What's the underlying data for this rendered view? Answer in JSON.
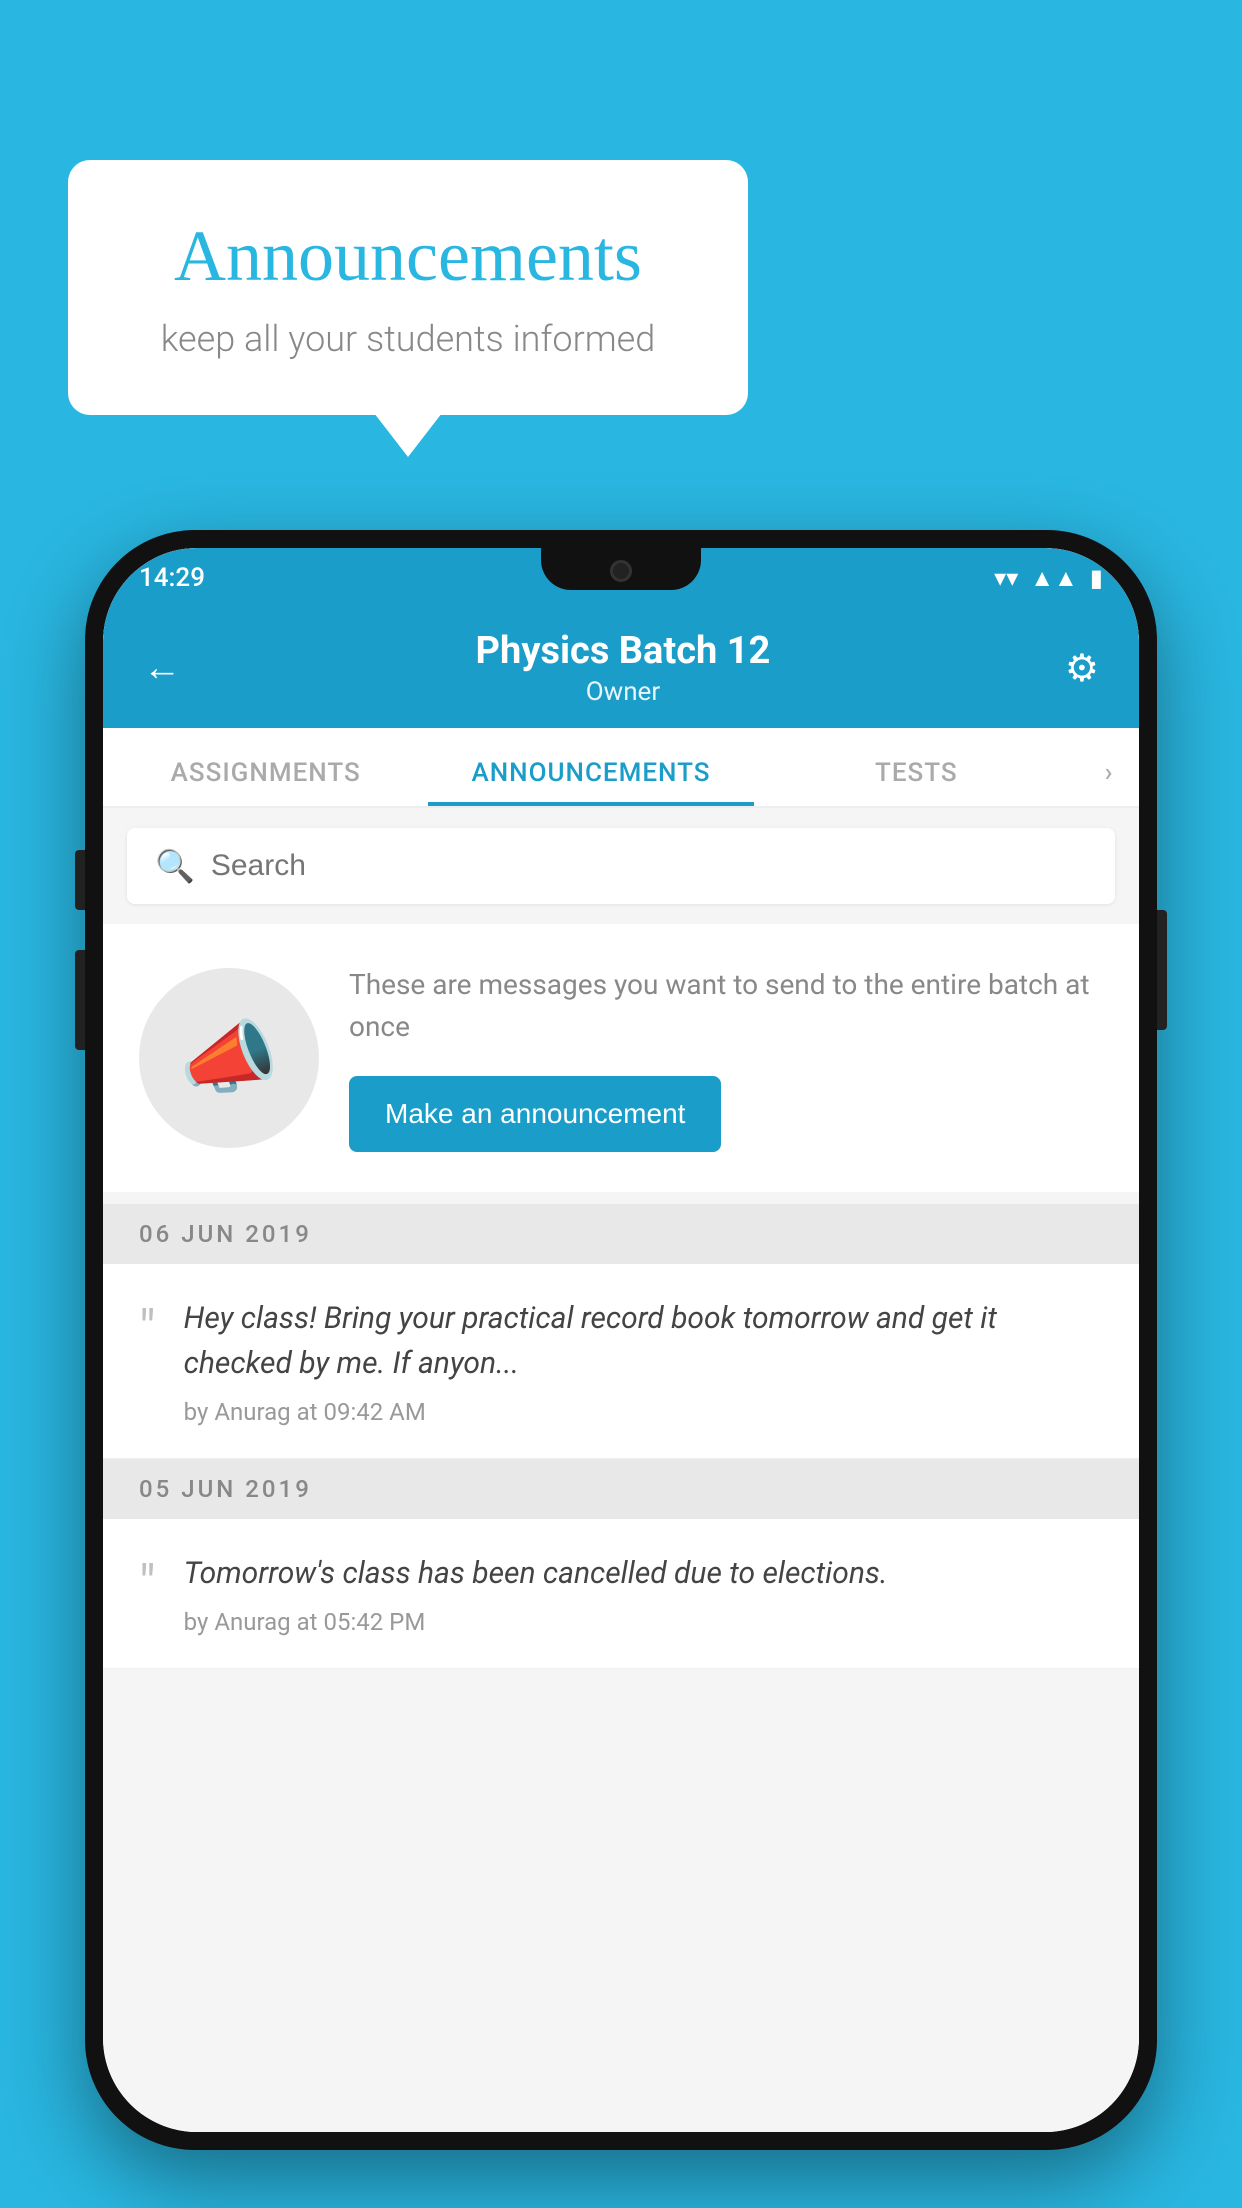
{
  "background_color": "#29b6e0",
  "speech_bubble": {
    "title": "Announcements",
    "subtitle": "keep all your students informed"
  },
  "phone": {
    "status_bar": {
      "time": "14:29",
      "wifi": "▼",
      "signal": "▲",
      "battery": "▮"
    },
    "header": {
      "title": "Physics Batch 12",
      "subtitle": "Owner",
      "back_label": "←",
      "gear_label": "⚙"
    },
    "tabs": [
      {
        "label": "ASSIGNMENTS",
        "active": false
      },
      {
        "label": "ANNOUNCEMENTS",
        "active": true
      },
      {
        "label": "TESTS",
        "active": false
      },
      {
        "label": "›",
        "active": false
      }
    ],
    "search": {
      "placeholder": "Search"
    },
    "promo": {
      "description": "These are messages you want to send to the entire batch at once",
      "button_label": "Make an announcement"
    },
    "announcements": [
      {
        "date": "06  JUN  2019",
        "message": "Hey class! Bring your practical record book tomorrow and get it checked by me. If anyon...",
        "meta": "by Anurag at 09:42 AM"
      },
      {
        "date": "05  JUN  2019",
        "message": "Tomorrow's class has been cancelled due to elections.",
        "meta": "by Anurag at 05:42 PM"
      }
    ]
  }
}
